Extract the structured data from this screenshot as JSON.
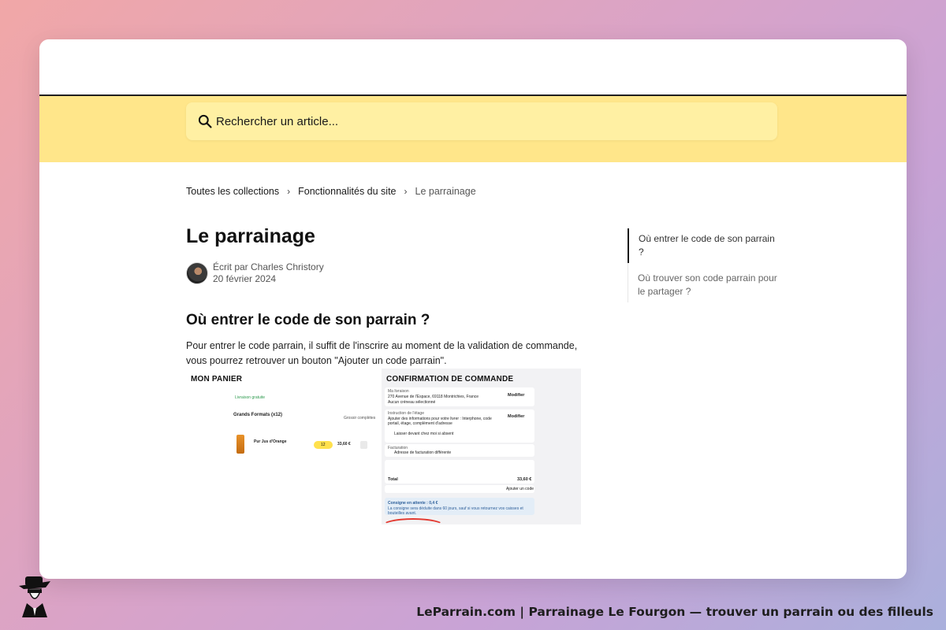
{
  "search": {
    "placeholder": "Rechercher un article..."
  },
  "breadcrumb": {
    "items": [
      "Toutes les collections",
      "Fonctionnalités du site",
      "Le parrainage"
    ],
    "separator": "›"
  },
  "article": {
    "title": "Le parrainage",
    "author_line": "Écrit par Charles Christory",
    "date": "20 février 2024",
    "section_heading": "Où entrer le code de son parrain ?",
    "paragraph_line1": "Pour entrer le code parrain, il suffit de l'inscrire au moment de la validation de commande,",
    "paragraph_line2": "vous pourrez retrouver un bouton \"Ajouter un code parrain\"."
  },
  "screenshot": {
    "cart_heading": "MON PANIER",
    "cart_status": "Livraison gratuite",
    "cart_group": "Grands Formats (x12)",
    "cart_group_count": "x12",
    "cart_group_action": "Grossir complètes",
    "cart_item": "Pur Jus d'Orange",
    "cart_qty": "12",
    "cart_price": "33,60 €",
    "confirm_heading": "CONFIRMATION DE COMMANDE",
    "address_label": "Ma livraison",
    "address_line": "270 Avenue de l'Espace, 69118 Montrichies, France",
    "slot_line": "Aucun créneau sélectionné",
    "modify": "Modifier",
    "instructions_label": "Instruction de l'étage",
    "instructions_line": "Ajouter des informations pour votre livrer : Interphone, code portail, étage, complément d'adresse",
    "leave_line": "Laisser devant chez moi si absent",
    "billing_label": "Facturation",
    "billing_line": "Adresse de facturation différente",
    "total_label": "Total",
    "total_value": "33,60 €",
    "add_code": "Ajouter un code",
    "deposit_title": "Consigne en attente : 0,4 €",
    "deposit_line": "La consigne sera déduite dans 60 jours, sauf si vous retournez vos caisses et bouteilles avant."
  },
  "toc": {
    "items": [
      {
        "label": "Où entrer le code de son parrain ?",
        "active": true
      },
      {
        "label": "Où trouver son code parrain pour le partager ?",
        "active": false
      }
    ]
  },
  "footer": {
    "text": "LeParrain.com | Parrainage Le Fourgon — trouver un parrain ou des filleuls"
  },
  "colors": {
    "hero_bg": "#ffe68a",
    "search_bg": "#fff0a3",
    "accent_red": "#e3382f"
  },
  "icons": {
    "search": "search-icon",
    "logo": "leparrain-logo-icon"
  }
}
